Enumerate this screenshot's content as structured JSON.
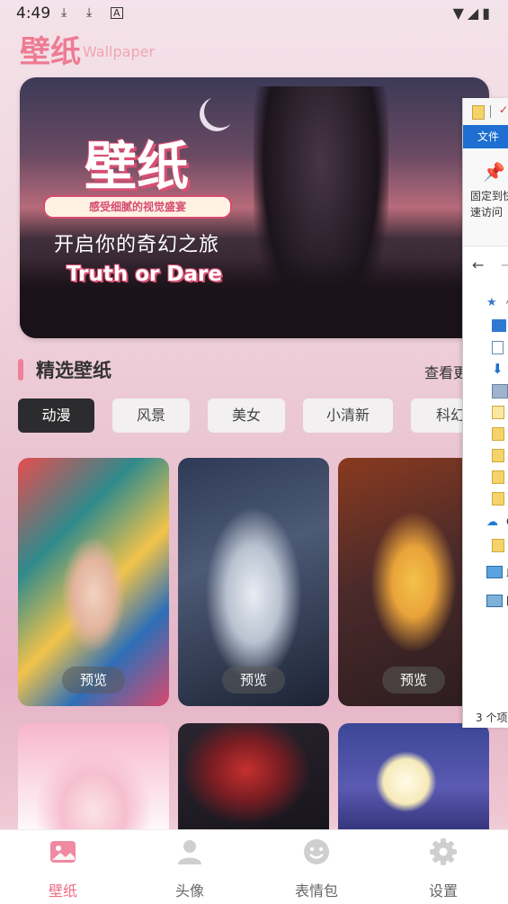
{
  "status_bar": {
    "time": "4:49",
    "left_icons": [
      "download-icon",
      "download-icon",
      "a-icon"
    ],
    "right_icons": [
      "wifi-icon",
      "signal-icon",
      "battery-icon"
    ]
  },
  "app": {
    "title_cn": "壁纸",
    "title_en": "Wallpaper",
    "accent": "#ee7b93"
  },
  "banner": {
    "title": "壁纸",
    "pill": "感受细腻的视觉盛宴",
    "subtitle": "开启你的奇幻之旅",
    "english": "Truth or Dare"
  },
  "section": {
    "title": "精选壁纸",
    "more": "查看更"
  },
  "categories": [
    {
      "label": "动漫",
      "active": true
    },
    {
      "label": "风景",
      "active": false
    },
    {
      "label": "美女",
      "active": false
    },
    {
      "label": "小清新",
      "active": false
    },
    {
      "label": "科幻",
      "active": false
    }
  ],
  "cards": {
    "preview_label": "预览"
  },
  "explorer": {
    "file_tab": "文件",
    "pin_label_line1": "固定到快",
    "pin_label_line2": "速访问",
    "tree_labels": [
      "快",
      "O",
      "此",
      "网"
    ],
    "item_count": "3 个项"
  },
  "tabbar": {
    "items": [
      {
        "label": "壁纸",
        "icon": "image-icon",
        "active": true
      },
      {
        "label": "头像",
        "icon": "user-icon",
        "active": false
      },
      {
        "label": "表情包",
        "icon": "smiley-icon",
        "active": false
      },
      {
        "label": "设置",
        "icon": "gear-icon",
        "active": false
      }
    ],
    "active_color": "#ec6d86",
    "inactive_color": "#cfcfcf"
  }
}
